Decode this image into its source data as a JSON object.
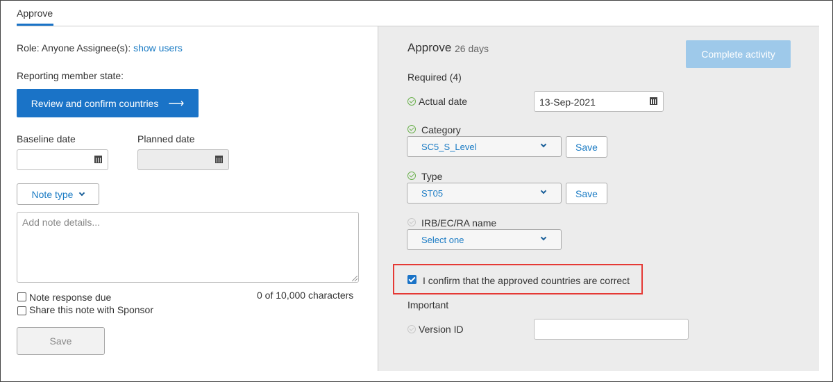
{
  "tabs": [
    {
      "label": "Approve"
    }
  ],
  "left": {
    "role_text": "Role: Anyone Assignee(s):",
    "show_users_link": "show users",
    "reporting_label": "Reporting member state:",
    "review_button": "Review and confirm countries",
    "review_arrow": "⟶",
    "baseline_label": "Baseline date",
    "planned_label": "Planned date",
    "note_type_button": "Note type",
    "note_placeholder": "Add note details...",
    "note_response_label": "Note response due",
    "share_label": "Share this note with Sponsor",
    "char_count": "0 of 10,000 characters",
    "save_button": "Save"
  },
  "right": {
    "title": "Approve",
    "days": "26 days",
    "complete_button": "Complete activity",
    "required_label": "Required (4)",
    "actual_date_label": "Actual date",
    "actual_date_value": "13-Sep-2021",
    "category_label": "Category",
    "category_value": "SC5_S_Level",
    "type_label": "Type",
    "type_value": "ST05",
    "save_label": "Save",
    "irb_label": "IRB/EC/RA name",
    "irb_value": "Select one",
    "confirm_label": "I confirm that the approved countries are correct",
    "confirm_checked": true,
    "important_label": "Important",
    "version_label": "Version ID",
    "version_value": ""
  },
  "colors": {
    "accent": "#1a73c7",
    "link": "#1a7bc4",
    "success": "#6ab04c",
    "highlight": "#e53935",
    "panel_bg": "#ececec"
  }
}
